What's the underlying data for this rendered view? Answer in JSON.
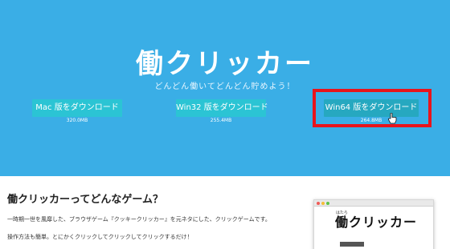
{
  "hero": {
    "logo": "働クリッカー",
    "tagline": "どんどん働いてどんどん貯めよう！",
    "background": "#3aaee6"
  },
  "downloads": [
    {
      "label": "Mac 版をダウンロード",
      "size": "320.0MB"
    },
    {
      "label": "Win32 版をダウンロード",
      "size": "255.4MB"
    },
    {
      "label": "Win64 版をダウンロード",
      "size": "264.8MB",
      "highlighted": true
    }
  ],
  "colors": {
    "button": "#2bc4d4",
    "button_highlight": "#26a8c0",
    "highlight_border": "#e8141c"
  },
  "about": {
    "title": "働クリッカーってどんなゲーム？",
    "paragraphs": [
      "一時期一世を風靡した、ブラウザゲーム『クッキークリッカー』を元ネタにした、クリックゲームです。",
      "操作方法も簡単。とにかくクリックしてクリックしてクリックするだけ！"
    ]
  },
  "preview": {
    "furigana": "はたら",
    "logo": "働クリッカー"
  }
}
